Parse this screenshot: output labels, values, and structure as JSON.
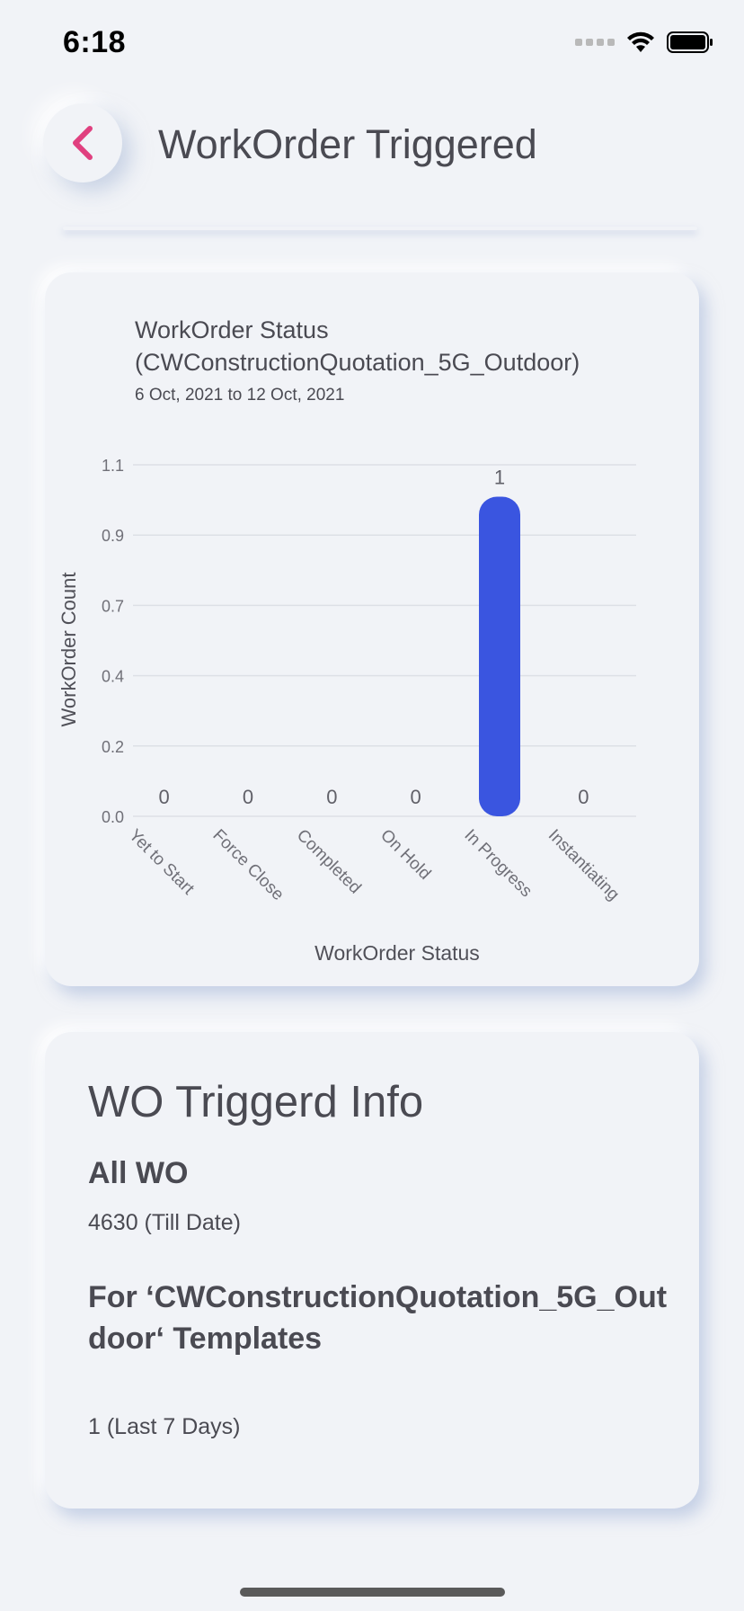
{
  "status_bar": {
    "time": "6:18",
    "icons": [
      "cellular-signal-icon",
      "wifi-icon",
      "battery-icon"
    ]
  },
  "header": {
    "title": "WorkOrder Triggered",
    "back_icon": "chevron-left-icon",
    "accent_color": "#e0407f"
  },
  "chart_card": {
    "title_line1": "WorkOrder Status",
    "title_line2": "(CWConstructionQuotation_5G_Outdoor)",
    "subtitle": "6 Oct, 2021 to 12 Oct, 2021"
  },
  "chart_data": {
    "type": "bar",
    "categories": [
      "Yet to Start",
      "Force Close",
      "Completed",
      "On Hold",
      "In Progress",
      "Instantiating"
    ],
    "values": [
      0,
      0,
      0,
      0,
      1,
      0
    ],
    "data_labels": [
      "0",
      "0",
      "0",
      "0",
      "1",
      "0"
    ],
    "xlabel": "WorkOrder Status",
    "ylabel": "WorkOrder Count",
    "y_ticks": [
      "0.0",
      "0.2",
      "0.4",
      "0.7",
      "0.9",
      "1.1"
    ],
    "y_tick_values": [
      0,
      0.22,
      0.44,
      0.66,
      0.88,
      1.1
    ],
    "ylim": [
      0,
      1.1
    ],
    "grid": true,
    "bar_color": "#3a55e0"
  },
  "info_card": {
    "heading": "WO Triggerd Info",
    "all_label": "All WO",
    "all_value": "4630 (Till Date)",
    "for_label": "For ‘CWConstructionQuotation_5G_Outdoor‘ Templates",
    "for_value": "1 (Last 7 Days)"
  }
}
